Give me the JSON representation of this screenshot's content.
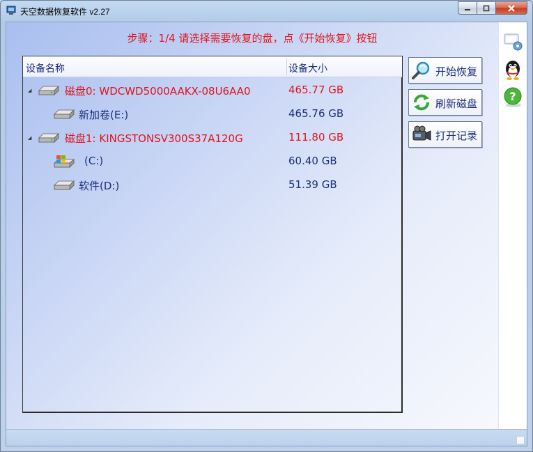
{
  "window": {
    "title": "天空数据恢复软件 v2.27"
  },
  "step_text": "步骤：1/4 请选择需要恢复的盘，点《开始恢复》按钮",
  "tree": {
    "columns": {
      "name": "设备名称",
      "size": "设备大小"
    },
    "rows": [
      {
        "label": "磁盘0: WDCWD5000AAKX-08U6AA0",
        "size": "465.77 GB",
        "kind": "disk",
        "icon": "hard-disk-icon"
      },
      {
        "label": "新加卷(E:)",
        "size": "465.76 GB",
        "kind": "volume",
        "icon": "drive-icon"
      },
      {
        "label": "磁盘1: KINGSTONSV300S37A120G",
        "size": "111.80 GB",
        "kind": "disk",
        "icon": "hard-disk-icon"
      },
      {
        "label": "(C:)",
        "size": "60.40 GB",
        "kind": "volume",
        "icon": "windows-drive-icon"
      },
      {
        "label": "软件(D:)",
        "size": "51.39 GB",
        "kind": "volume",
        "icon": "drive-icon"
      }
    ]
  },
  "buttons": {
    "start": {
      "label": "开始恢复",
      "icon": "magnifier-icon"
    },
    "refresh": {
      "label": "刷新磁盘",
      "icon": "refresh-icon"
    },
    "log": {
      "label": "打开记录",
      "icon": "camcorder-icon"
    }
  },
  "colors": {
    "accent_red": "#e0141b",
    "text_blue": "#1c2f7a"
  }
}
